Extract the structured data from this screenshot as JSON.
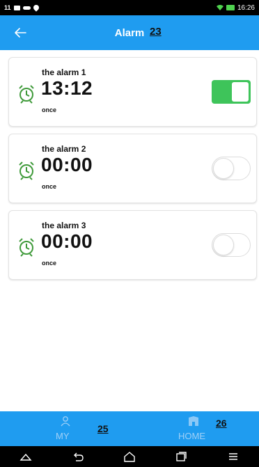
{
  "status_bar": {
    "left_number": "11",
    "time": "16:26"
  },
  "header": {
    "title": "Alarm",
    "badge": "23",
    "back_icon": "arrow-left-icon"
  },
  "alarms": [
    {
      "name": "the alarm 1",
      "time": "13:12",
      "repeat": "once",
      "enabled": true
    },
    {
      "name": "the alarm 2",
      "time": "00:00",
      "repeat": "once",
      "enabled": false
    },
    {
      "name": "the alarm 3",
      "time": "00:00",
      "repeat": "once",
      "enabled": false
    }
  ],
  "bottom_tabs": [
    {
      "label": "MY",
      "icon": "person-icon",
      "badge": "25"
    },
    {
      "label": "HOME",
      "icon": "home-icon",
      "badge": "26"
    }
  ],
  "colors": {
    "primary": "#1f9cf0",
    "toggle_on": "#3ec45a",
    "alarm_icon": "#3f9a3a"
  },
  "system_nav": [
    "home-shape-icon",
    "back-icon",
    "home-icon",
    "recents-icon",
    "menu-icon"
  ]
}
